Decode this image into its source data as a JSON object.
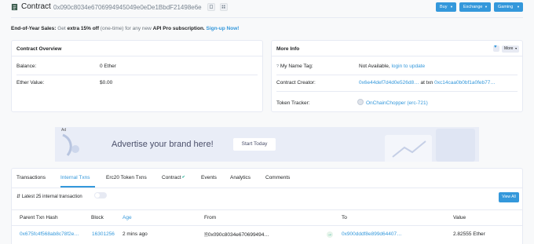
{
  "header": {
    "title": "Contract",
    "address": "0x090c8034e6706994945049e0eDe1BbdF21498e6e",
    "copy_icon": "copy-icon",
    "qr_icon": "qr-icon"
  },
  "top_buttons": {
    "buy": "Buy",
    "exchange": "Exchange",
    "gaming": "Gaming"
  },
  "promo": {
    "prefix": "End-of-Year Sales:",
    "middle": " Get ",
    "bold": "extra 15% off",
    "after": " (one-time) for any new ",
    "bold2": "API Pro subscription.",
    "link": " Sign-up Now!"
  },
  "overview": {
    "title": "Contract Overview",
    "balance_label": "Balance:",
    "balance_value": "0 Ether",
    "ether_value_label": "Ether Value:",
    "ether_value": "$0.00"
  },
  "more_info": {
    "title": "More Info",
    "more_button": "More",
    "name_tag_label": "My Name Tag:",
    "name_tag_value": "Not Available,",
    "name_tag_link": "login to update",
    "creator_label": "Contract Creator:",
    "creator_address": "0x6e44def7d4d0e526d8…",
    "creator_txn_prefix": "at txn",
    "creator_txn": "0xc14caa0b0bf1a0feb77…",
    "token_tracker_label": "Token Tracker:",
    "token_tracker_value": "OnChainChopper (erc-721)"
  },
  "ad": {
    "tag": "Ad",
    "headline": "Advertise your brand here!",
    "button": "Start Today"
  },
  "tabs": {
    "items": [
      "Transactions",
      "Internal Txns",
      "Erc20 Token Txns",
      "Contract",
      "Events",
      "Analytics",
      "Comments"
    ],
    "active": "Internal Txns"
  },
  "internal": {
    "summary": "Latest 25 internal transaction",
    "view_all": "View All",
    "columns": [
      "Parent Txn Hash",
      "Block",
      "Age",
      "From",
      "To",
      "Value"
    ],
    "rows": [
      {
        "hash": "0x675fc4f568ab8c78f2e…",
        "block": "16301256",
        "age": "2 mins ago",
        "from": "0x090c8034e670699494…",
        "to": "0x900dddf8e899d64407…",
        "value": "2.82555 Ether"
      }
    ]
  },
  "colors": {
    "accent": "#3498db",
    "success": "#00a186"
  }
}
